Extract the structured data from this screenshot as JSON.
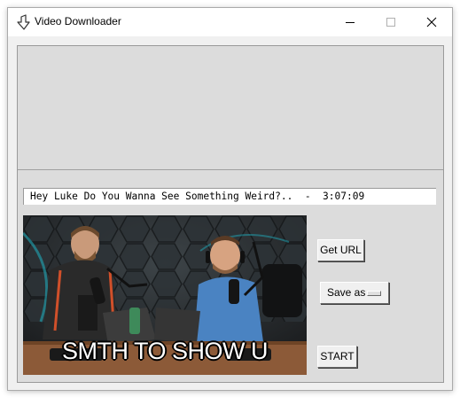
{
  "window": {
    "title": "Video Downloader",
    "icon": "download-arrow-icon",
    "controls": [
      "minimize-icon",
      "maximize-icon",
      "close-icon"
    ]
  },
  "video_info": "Hey Luke Do You Wanna See Something Weird?..  -  3:07:09",
  "thumbnail": {
    "caption": "SMTH TO SHOW U"
  },
  "buttons": {
    "get_url": "Get URL",
    "save_as": "Save as",
    "start": "START"
  },
  "colors": {
    "window_bg": "#f0f0f0",
    "panel_bg": "#dcdcdc",
    "field_bg": "#ffffff"
  }
}
